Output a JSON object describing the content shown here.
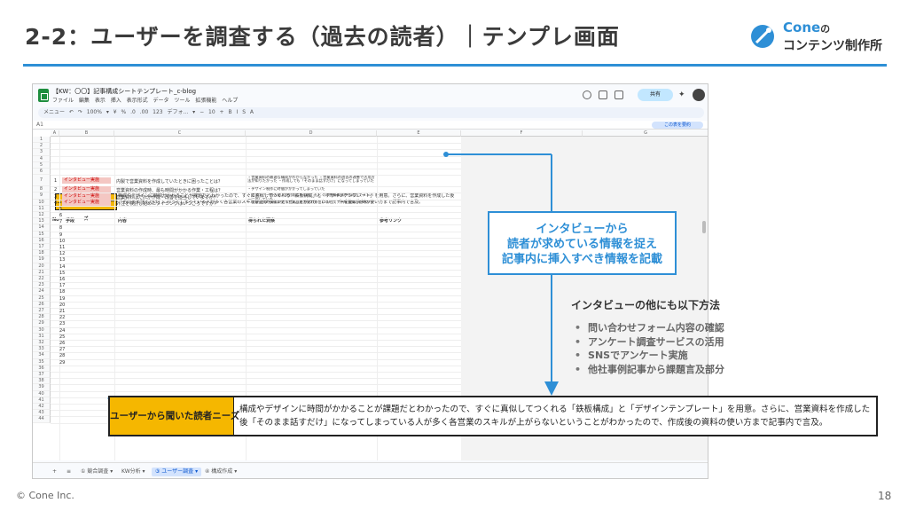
{
  "header": {
    "title": "2-2：ユーザーを調査する（過去の読者）｜テンプレ画面",
    "logo_brand": "Cone",
    "logo_no": "の",
    "logo_sub": "コンテンツ制作所"
  },
  "footer": {
    "copyright": "© Cone Inc.",
    "page": "18"
  },
  "sheet": {
    "doc_title": "【KW：〇〇】記事構成シートテンプレート_c-blog",
    "menu": "ファイル 編集 表示 挿入 表示形式 データ ツール 拡張機能 ヘルプ",
    "share_label": "共有",
    "toolbar": "メニュー ↶ ↷ 100% ▾ ¥ % .0 .00 123 デフォ... ▾ − 10 + B I S A",
    "cell_ref": "A1",
    "summarize_label": "この表を要約",
    "columns": [
      "A",
      "B",
      "C",
      "D",
      "E",
      "F",
      "G"
    ],
    "need_label": "ユーザーから聞いた読者ニーズ",
    "need_text": "構成やデザインに時間がかかることが課題だとわかったので、すぐに真似してつくれる「鉄板構成」と「デザインテンプレート」を用意。さらに、営業資料を作成した後「そのまま話すだけ」になってしまっている人が多く各営業のスキルが上がらないということがわかったので、作成後の資料の使い方まで記事内で言及。",
    "table_headers": {
      "no": "No",
      "method": "手段",
      "content": "内容",
      "result": "得られた洞察",
      "link": "参考リンク"
    },
    "rows": [
      {
        "no": "1",
        "method": "インタビュー実施",
        "content": "内製で営業資料を作成していたときに困ったことは？",
        "result": "・営業資料の最適な構成がわからなかった ・営業資料の過去の改善で活用方法が知りたかった ・作成しても「そのまま話すだけ」になってしまっていた"
      },
      {
        "no": "2",
        "method": "インタビュー実施",
        "content": "営業資料の作成時、最も時間がかかる作業・工程は？",
        "result": "・デザイン制作に時間がかかってしまっていた"
      },
      {
        "no": "3",
        "method": "インタビュー実施",
        "content": "営業資料はだれが作成・改善を担当していますか？",
        "result": "・各メンバー個人個人が対応している、もしくは営業事務が作成してメンバーに渡していた"
      },
      {
        "no": "4",
        "method": "インタビュー実施",
        "content": "外注を検討し始めたタイミングはいつごろですか？",
        "result": "・営業資料の構成次第で営業成果が変わるというセミナーを受講した時から"
      }
    ],
    "tabs": [
      "+",
      "≡",
      "① 競合調査 ▾",
      "KW分析 ▾",
      "③ ユーザー調査 ▾",
      "④ 構成作成 ▾"
    ]
  },
  "callout": {
    "lines": [
      "インタビューから",
      "読者が求めている情報を捉え",
      "記事内に挿入すべき情報を記載"
    ]
  },
  "other_methods": {
    "title": "インタビューの他にも以下方法",
    "items": [
      "問い合わせフォーム内容の確認",
      "アンケート調査サービスの活用",
      "SNSでアンケート実施",
      "他社事例記事から課題言及部分"
    ]
  },
  "zoom": {
    "label": "ユーザーから聞いた読者ニーズ",
    "text": "構成やデザインに時間がかかることが課題だとわかったので、すぐに真似してつくれる「鉄板構成」と「デザインテンプレート」を用意。さらに、営業資料を作成した後「そのまま話すだけ」になってしまっている人が多く各営業のスキルが上がらないということがわかったので、作成後の資料の使い方まで記事内で言及。"
  },
  "colors": {
    "accent": "#2e8fd6",
    "need_yellow": "#f5b700",
    "interview_red": "#f4c7c3"
  }
}
